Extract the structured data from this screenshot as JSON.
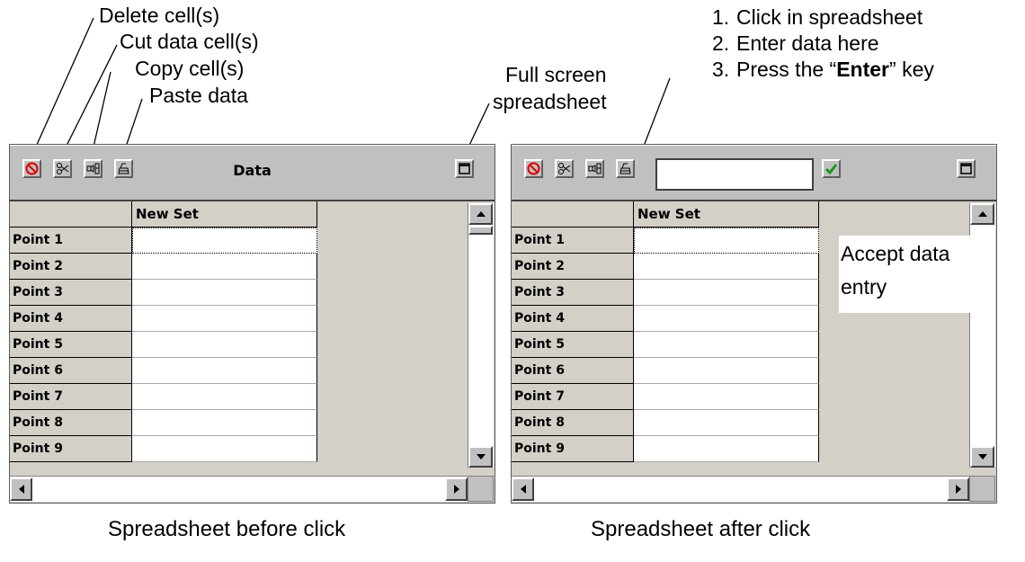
{
  "annotations": {
    "delete": "Delete cell(s)",
    "cut": "Cut data cell(s)",
    "copy": "Copy cell(s)",
    "paste": "Paste data",
    "fullscreen_line1": "Full screen",
    "fullscreen_line2": "spreadsheet",
    "accept_line1": "Accept data",
    "accept_line2": "entry"
  },
  "steps": [
    {
      "num": "1.",
      "text": "Click in spreadsheet"
    },
    {
      "num": "2.",
      "text": "Enter data here"
    },
    {
      "num": "3.",
      "pre": "Press the “",
      "bold": "Enter",
      "post": "” key"
    }
  ],
  "window_before": {
    "title": "Data",
    "column_header": "New Set",
    "rows": [
      "Point 1",
      "Point 2",
      "Point 3",
      "Point 4",
      "Point 5",
      "Point 6",
      "Point 7",
      "Point 8",
      "Point 9"
    ],
    "selected_row": 1
  },
  "window_after": {
    "column_header": "New Set",
    "entry_value": "",
    "rows": [
      "Point 1",
      "Point 2",
      "Point 3",
      "Point 4",
      "Point 5",
      "Point 6",
      "Point 7",
      "Point 8",
      "Point 9"
    ],
    "selected_row": 1
  },
  "captions": {
    "before": "Spreadsheet before click",
    "after": "Spreadsheet after click"
  },
  "colors": {
    "toolbar": "#c0c0c0",
    "window": "#d4d0c8",
    "delete_icon": "#e00000",
    "accept_icon": "#1a9a1a"
  },
  "icons": [
    "delete-icon",
    "scissors-icon",
    "copy-icon",
    "paste-icon",
    "fullscreen-icon",
    "checkmark-icon",
    "arrow-up-icon",
    "arrow-down-icon",
    "arrow-left-icon",
    "arrow-right-icon"
  ]
}
